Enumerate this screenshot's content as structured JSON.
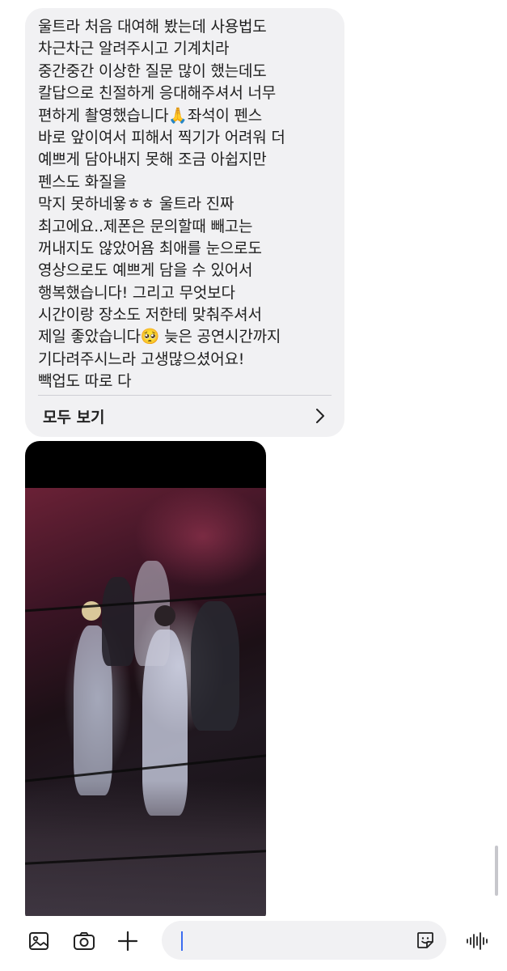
{
  "message": {
    "lines": [
      "울트라 처음 대여해 봤는데 사용법도",
      "차근차근 알려주시고 기계치라",
      "중간중간 이상한 질문 많이 했는데도",
      "칼답으로 친절하게 응대해주셔서 너무",
      "편하게 촬영했습니다🙏좌석이 펜스",
      "바로 앞이여서 피해서 찍기가 어려워 더",
      "예쁘게 담아내지 못해 조금 아쉽지만",
      "펜스도 화질을",
      "막지 못하네욯ㅎㅎ 울트라 진짜",
      "최고에요..제폰은 문의할때 빼고는",
      "꺼내지도 않았어욤 최애를 눈으로도",
      "영상으로도 예쁘게 담을 수 있어서",
      "행복했습니다! 그리고 무엇보다",
      "시간이랑 장소도 저한테 맞춰주셔서",
      "제일 좋았습니다🥺 늦은 공연시간까지",
      "기다려주시느라 고생많으셨어요!",
      "빽업도 따로 다"
    ],
    "see_all_label": "모두 보기"
  },
  "input": {
    "placeholder": ""
  },
  "icons": {
    "gallery": "image-icon",
    "camera": "camera-icon",
    "add": "plus-icon",
    "sticker": "sticker-icon",
    "voice": "voice-wave-icon"
  },
  "colors": {
    "bubble": "#f1f1f3",
    "caret": "#3b6cf0"
  }
}
